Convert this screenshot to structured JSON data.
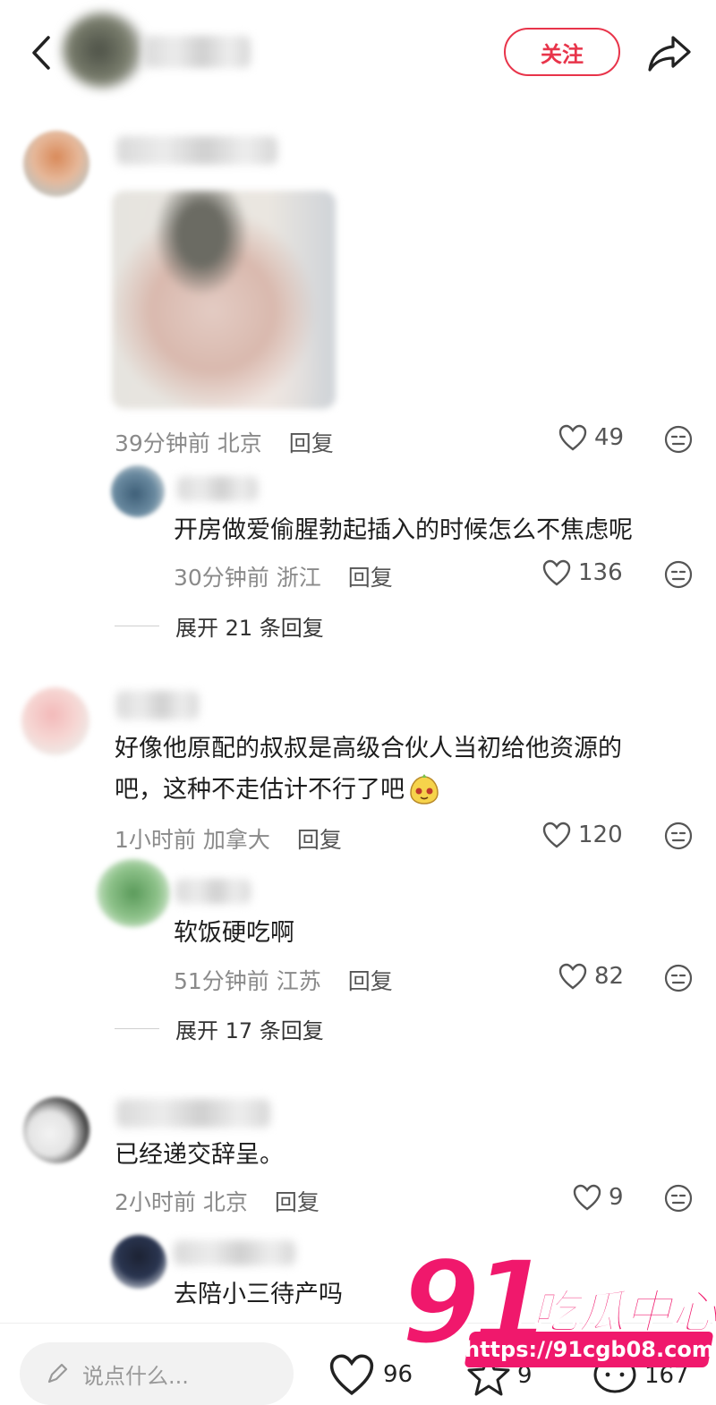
{
  "header": {
    "follow_label": "关注"
  },
  "comments": [
    {
      "meta_time": "39分钟前",
      "meta_loc": "北京",
      "reply_label": "回复",
      "likes": "49",
      "replies": [
        {
          "text": "开房做爱偷腥勃起插入的时候怎么不焦虑呢",
          "meta_time": "30分钟前",
          "meta_loc": "浙江",
          "reply_label": "回复",
          "likes": "136"
        }
      ],
      "expand_label": "展开 21 条回复"
    },
    {
      "text_line1": "好像他原配的叔叔是高级合伙人当初给他资源的",
      "text_line2": "吧，这种不走估计不行了吧",
      "meta_time": "1小时前",
      "meta_loc": "加拿大",
      "reply_label": "回复",
      "likes": "120",
      "replies": [
        {
          "text": "软饭硬吃啊",
          "meta_time": "51分钟前",
          "meta_loc": "江苏",
          "reply_label": "回复",
          "likes": "82"
        }
      ],
      "expand_label": "展开 17 条回复"
    },
    {
      "text": "已经递交辞呈。",
      "meta_time": "2小时前",
      "meta_loc": "北京",
      "reply_label": "回复",
      "likes": "9",
      "replies": [
        {
          "text": "去陪小三待产吗"
        }
      ]
    }
  ],
  "bottom_bar": {
    "input_placeholder": "说点什么...",
    "like_count": "96",
    "star_count": "9",
    "comment_count": "167"
  },
  "watermark": {
    "logo_number": "91",
    "logo_text": "吃瓜中心",
    "url": "https://91cgb08.com"
  },
  "colors": {
    "accent": "#e8344a",
    "meta_gray": "#8a8a8a",
    "watermark_pink": "#f0186c"
  }
}
